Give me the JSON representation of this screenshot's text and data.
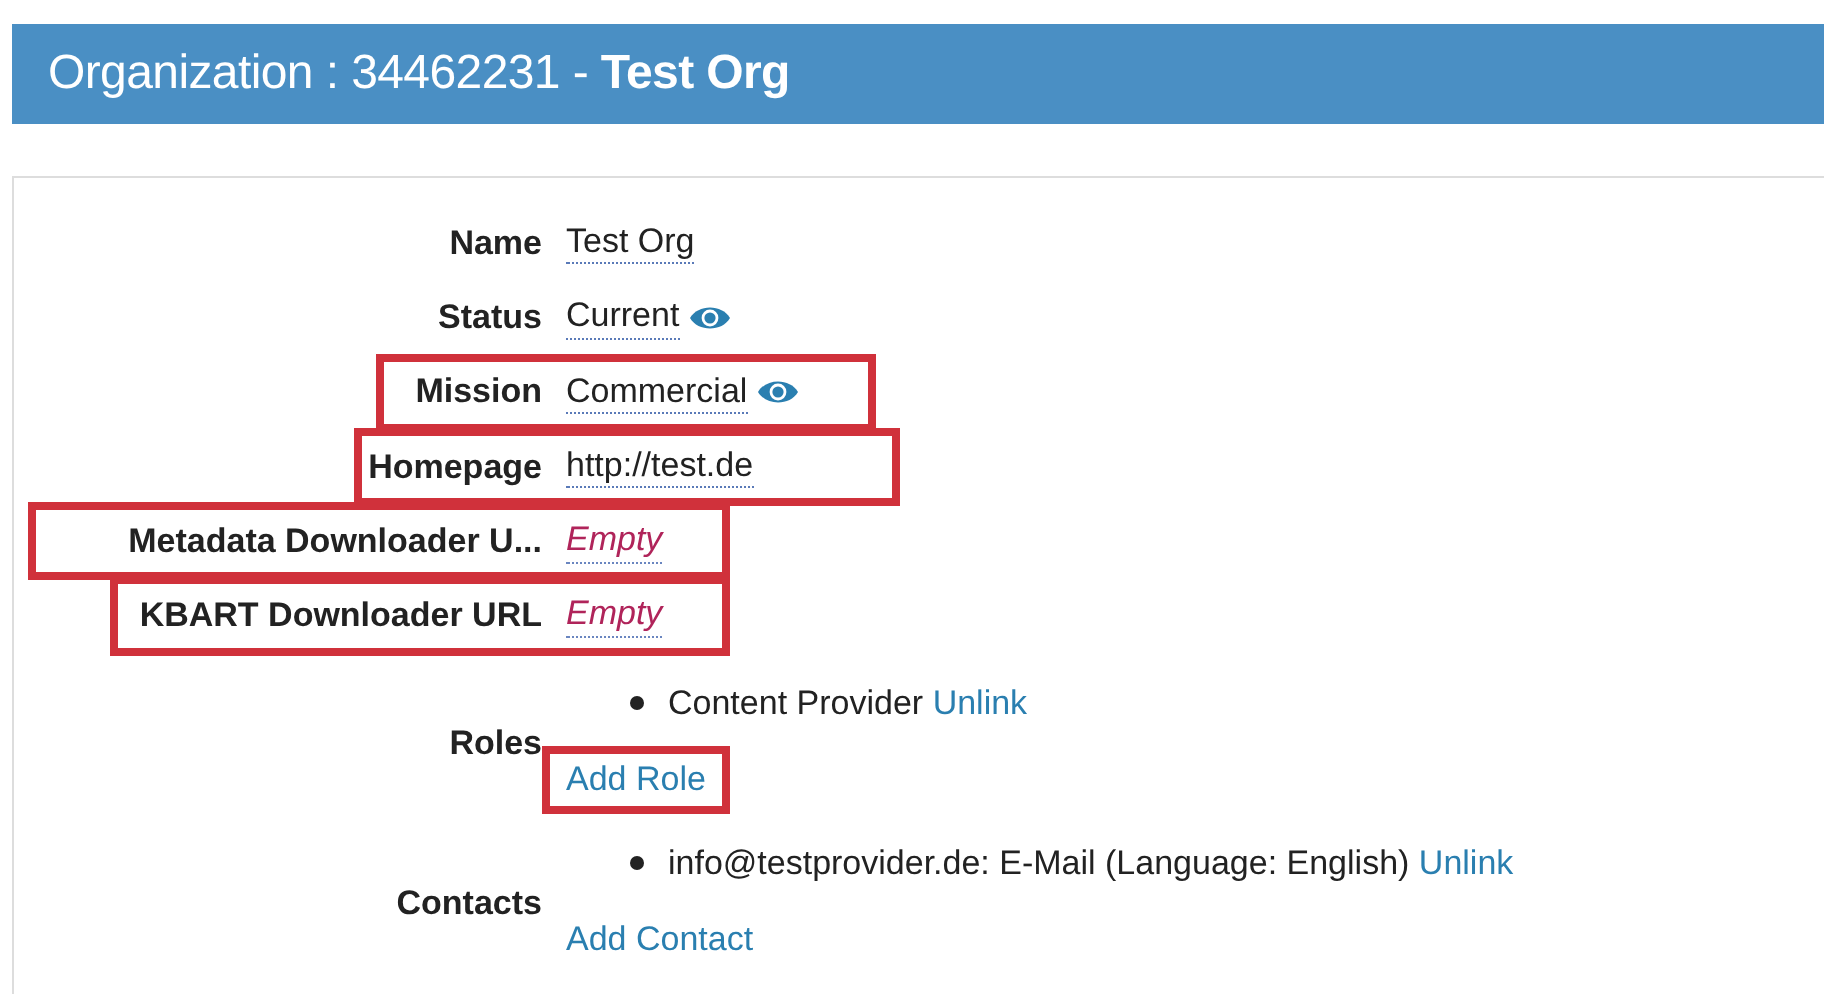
{
  "header": {
    "title": "Organization : 34462231 - **Test Org**"
  },
  "fields": [
    {
      "label": "Name",
      "value": "Test Org",
      "empty": false,
      "visibility_icon": false,
      "highlighted": false
    },
    {
      "label": "Status",
      "value": "Current",
      "empty": false,
      "visibility_icon": true,
      "highlighted": false
    },
    {
      "label": "Mission",
      "value": "Commercial",
      "empty": false,
      "visibility_icon": true,
      "highlighted": true
    },
    {
      "label": "Homepage",
      "value": "http://test.de",
      "empty": false,
      "visibility_icon": false,
      "highlighted": true
    },
    {
      "label": "Metadata Downloader U...",
      "value": "Empty",
      "empty": true,
      "visibility_icon": false,
      "highlighted": true
    },
    {
      "label": "KBART Downloader URL",
      "value": "Empty",
      "empty": true,
      "visibility_icon": false,
      "highlighted": true
    }
  ],
  "lists": [
    {
      "label": "Roles",
      "items": [
        {
          "text": "Content Provider",
          "action": "Unlink"
        }
      ],
      "add": "Add Role",
      "add_highlighted": true
    },
    {
      "label": "Contacts",
      "items": [
        {
          "text": "info@testprovider.de: E-Mail (Language: English)",
          "action": "Unlink"
        }
      ],
      "add": "Add Contact",
      "add_highlighted": false
    }
  ]
}
